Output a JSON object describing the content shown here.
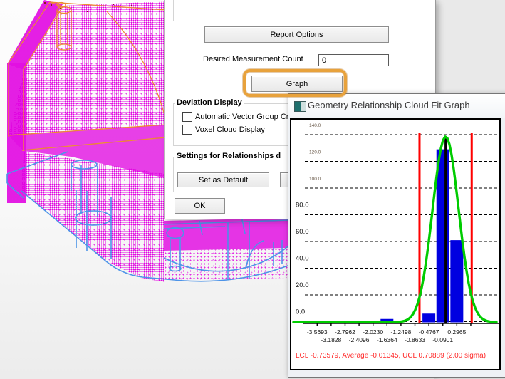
{
  "dialog": {
    "report_options_label": "Report Options",
    "measurement_count_label": "Desired Measurement Count",
    "measurement_count_value": "0",
    "graph_label": "Graph",
    "deviation_display": {
      "title": "Deviation Display",
      "checkbox_auto_vector": "Automatic Vector Group Cre",
      "checkbox_voxel": "Voxel Cloud Display"
    },
    "settings_group": {
      "title": "Settings for Relationships d"
    },
    "set_as_default_label": "Set as Default",
    "ok_label": "OK"
  },
  "popup": {
    "title": "Geometry Relationship Cloud Fit Graph",
    "footer": "LCL -0.73579, Average -0.01345, UCL 0.70889 (2.00 sigma)"
  },
  "chart_data": {
    "type": "bar",
    "title": "Geometry Relationship Cloud Fit Graph",
    "ylim": [
      0,
      140
    ],
    "y_ticks": [
      0,
      20,
      40,
      60,
      80,
      100,
      120,
      140
    ],
    "y_tick_labels": [
      "0.0",
      "20.0",
      "40.0",
      "60.0",
      "80.0",
      "100.0",
      "120.0",
      "140.0"
    ],
    "x_start": -3.5693,
    "x_step": 0.3866,
    "num_ticks": 12,
    "x_tick_labels_row1": [
      "-3.5693",
      "-2.7962",
      "-2.0230",
      "-1.2498",
      "-0.4767",
      "0.2965"
    ],
    "x_tick_labels_row2": [
      "-3.1828",
      "-2.4096",
      "-1.6364",
      "-0.8633",
      "-0.0901"
    ],
    "bin_width": 0.3866,
    "bars": [
      {
        "x": -1.6364,
        "h": 2
      },
      {
        "x": -0.4767,
        "h": 6
      },
      {
        "x": -0.0901,
        "h": 129
      },
      {
        "x": 0.2965,
        "h": 61
      }
    ],
    "normal_fit": {
      "mean": -0.01345,
      "sigma": 0.36117,
      "peak": 139
    },
    "lcl": -0.73579,
    "ucl": 0.70889,
    "average": -0.01345,
    "sigma_label": "2.00 sigma",
    "grid": "dashed",
    "colors": {
      "bar": "#0000e0",
      "fit": "#00cc00",
      "limit": "#ff0000",
      "mean": "#000000",
      "annotation": "#ff2a2a"
    }
  },
  "callout": {
    "color": "#e8a23c"
  }
}
